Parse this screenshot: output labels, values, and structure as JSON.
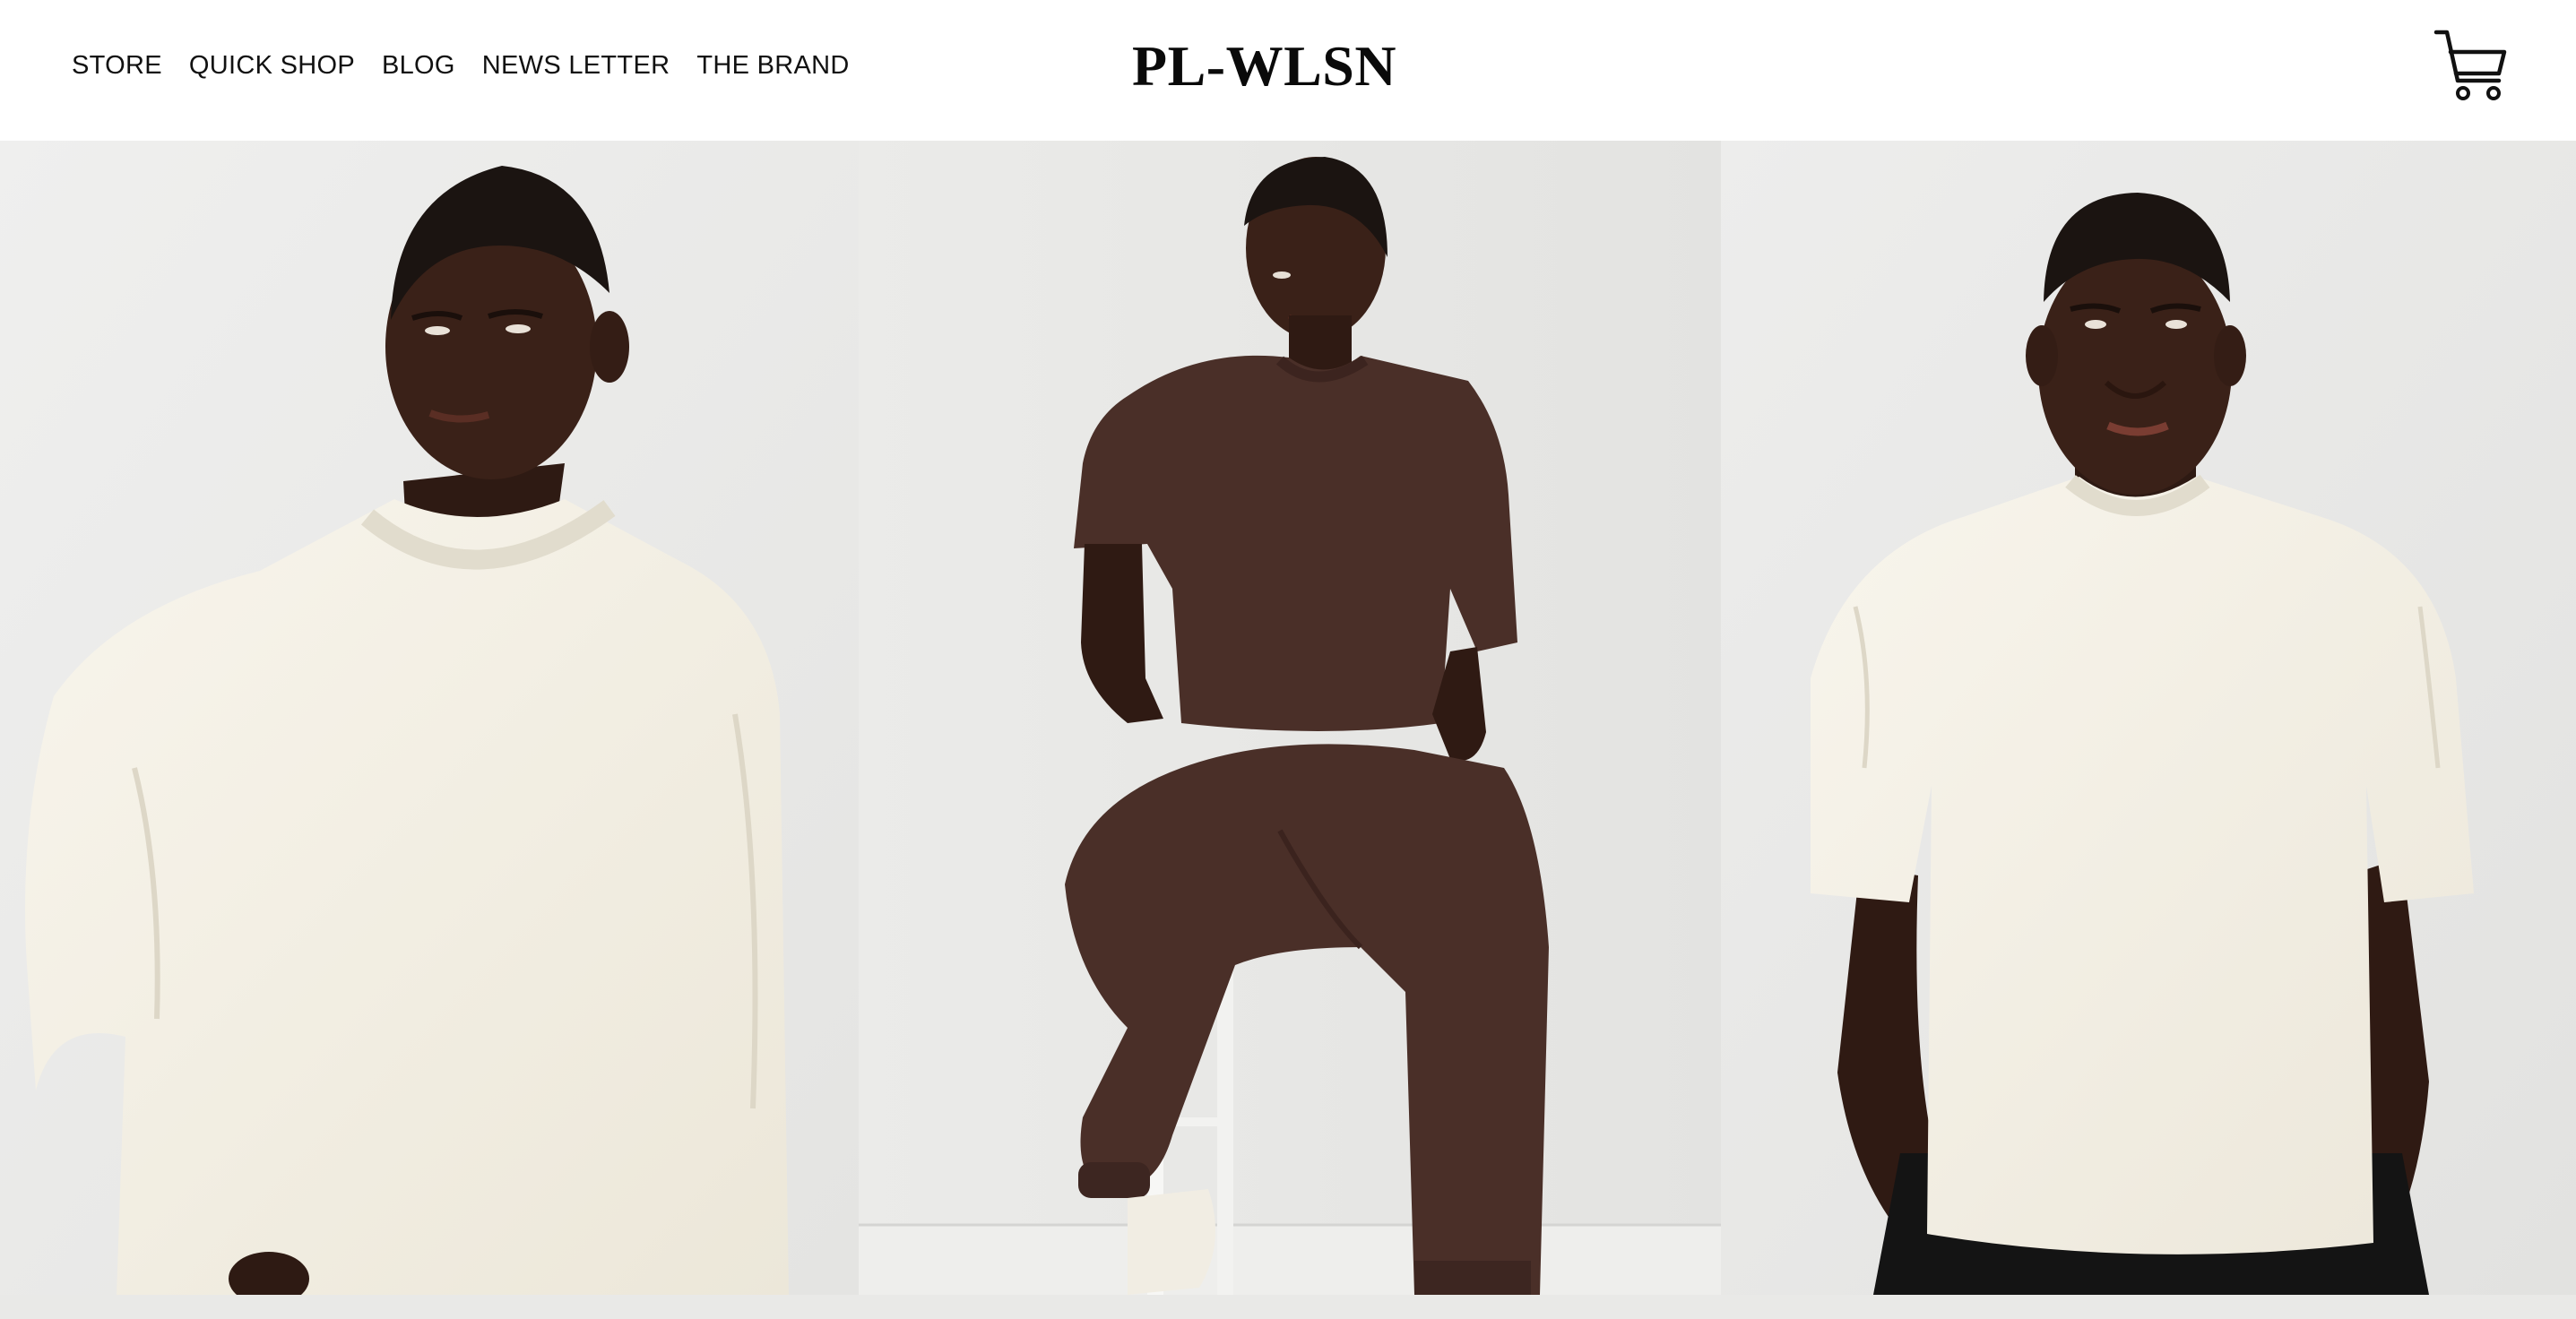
{
  "nav": {
    "items": [
      {
        "label": "STORE"
      },
      {
        "label": "QUICK SHOP"
      },
      {
        "label": "BLOG"
      },
      {
        "label": "NEWS LETTER"
      },
      {
        "label": "THE BRAND"
      }
    ]
  },
  "brand": {
    "logo_text": "PL-WLSN"
  },
  "cart": {
    "icon": "shopping-cart-icon"
  },
  "hero": {
    "panels": [
      {
        "name": "model-cream-sweatshirt",
        "garment_color": "#f3efe3"
      },
      {
        "name": "model-brown-tee-joggers",
        "garment_color": "#4a2f28"
      },
      {
        "name": "model-cream-tshirt",
        "garment_color": "#f4f0e5"
      }
    ]
  },
  "colors": {
    "text": "#111111",
    "background": "#ffffff",
    "backdrop": "#ebebea",
    "skin": "#3b2219",
    "hair": "#1b1411"
  }
}
